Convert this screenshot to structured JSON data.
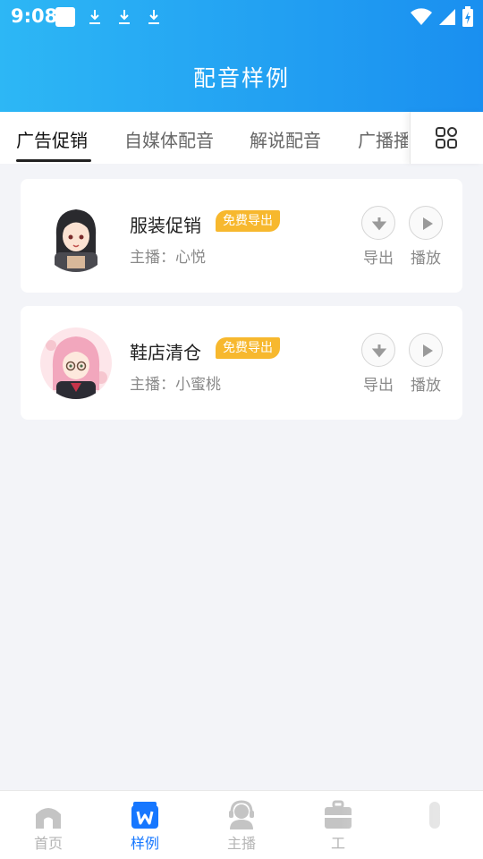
{
  "status_bar": {
    "time": "9:08"
  },
  "header": {
    "title": "配音样例"
  },
  "tabs": [
    {
      "label": "广告促销",
      "active": true
    },
    {
      "label": "自媒体配音",
      "active": false
    },
    {
      "label": "解说配音",
      "active": false
    },
    {
      "label": "广播播",
      "active": false
    }
  ],
  "tabs_more_icon": "grid-icon",
  "samples": [
    {
      "title": "服装促销",
      "badge": "免费导出",
      "host": "主播：心悦",
      "export_label": "导出",
      "play_label": "播放"
    },
    {
      "title": "鞋店清仓",
      "badge": "免费导出",
      "host": "主播：小蜜桃",
      "export_label": "导出",
      "play_label": "播放"
    }
  ],
  "bottom_nav": [
    {
      "label": "首页",
      "icon": "home-icon",
      "active": false
    },
    {
      "label": "样例",
      "icon": "samples-icon",
      "active": true
    },
    {
      "label": "主播",
      "icon": "headset-icon",
      "active": false
    },
    {
      "label": "工",
      "icon": "toolbox-icon",
      "active": false
    },
    {
      "label": "",
      "icon": "user-icon",
      "active": false
    }
  ],
  "colors": {
    "accent": "#1677ff",
    "header_start": "#2db7f5",
    "header_end": "#1a8ff0",
    "badge": "#f7b82e"
  }
}
